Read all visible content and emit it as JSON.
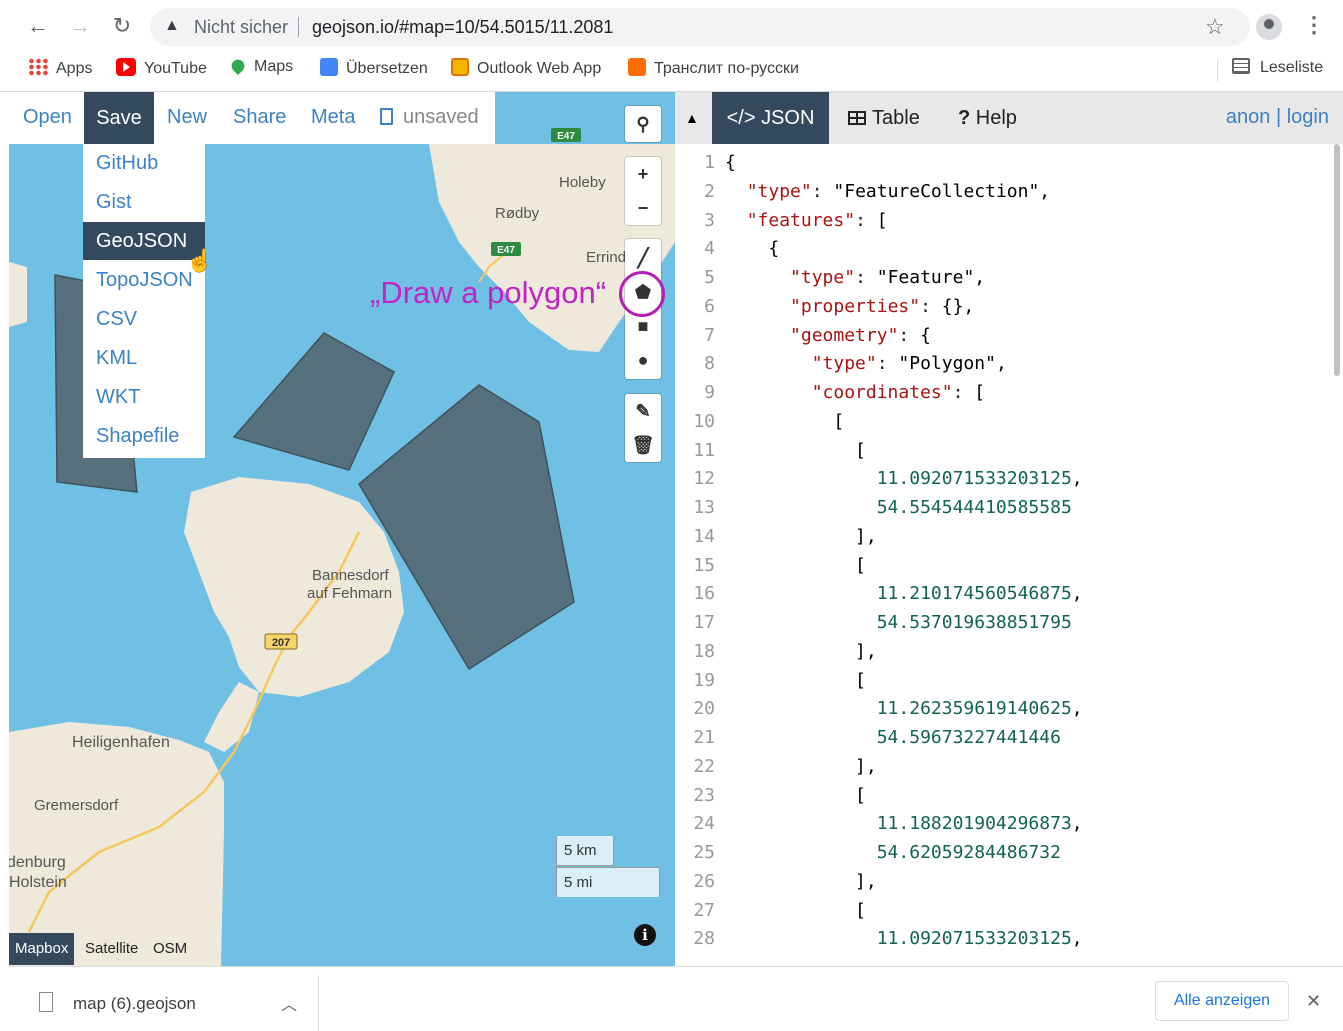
{
  "browser": {
    "insecure_label": "Nicht sicher",
    "url": "geojson.io/#map=10/54.5015/11.2081",
    "bookmarks": [
      {
        "label": "Apps",
        "icon": "apps-grid-icon"
      },
      {
        "label": "YouTube",
        "icon": "youtube-icon"
      },
      {
        "label": "Maps",
        "icon": "maps-pin-icon"
      },
      {
        "label": "Übersetzen",
        "icon": "translate-icon"
      },
      {
        "label": "Outlook Web App",
        "icon": "outlook-icon"
      },
      {
        "label": "Транслит по-русски",
        "icon": "translit-icon"
      }
    ],
    "reading_list": "Leseliste"
  },
  "app": {
    "menu": {
      "open": "Open",
      "save": "Save",
      "new": "New",
      "share": "Share",
      "meta": "Meta",
      "unsaved": "unsaved"
    },
    "save_dropdown": [
      "GitHub",
      "Gist",
      "GeoJSON",
      "TopoJSON",
      "CSV",
      "KML",
      "WKT",
      "Shapefile"
    ],
    "save_dropdown_active": "GeoJSON",
    "annotation": "„Draw a polygon“",
    "map_labels": {
      "holeby": "Holeby",
      "rodby": "Rødby",
      "errind": "Errind",
      "bannesdorf_1": "Bannesdorf",
      "bannesdorf_2": "auf Fehmarn",
      "heiligenhafen": "Heiligenhafen",
      "gremersdorf": "Gremersdorf",
      "oldenburg_1": "denburg",
      "oldenburg_2": "Holstein",
      "road_e47_a": "E47",
      "road_e47_b": "E47",
      "road_207": "207"
    },
    "scale": {
      "km": "5 km",
      "mi": "5 mi"
    },
    "layers": {
      "mapbox": "Mapbox",
      "satellite": "Satellite",
      "osm": "OSM",
      "active": "Mapbox"
    },
    "colors": {
      "accent": "#34495e",
      "link": "#3c82c8",
      "water": "#70c0e6",
      "land": "#efe9dc",
      "polygon": "#56707d"
    }
  },
  "panel": {
    "tabs": {
      "json": "</> JSON",
      "table": "Table",
      "help": "Help"
    },
    "help_glyph": "?",
    "active_tab": "JSON",
    "auth": {
      "anon": "anon",
      "separator": "|",
      "login": "login"
    },
    "code_lines": [
      {
        "n": "1",
        "t": "{"
      },
      {
        "n": "2",
        "t": "  \"type\": \"FeatureCollection\","
      },
      {
        "n": "3",
        "t": "  \"features\": ["
      },
      {
        "n": "4",
        "t": "    {"
      },
      {
        "n": "5",
        "t": "      \"type\": \"Feature\","
      },
      {
        "n": "6",
        "t": "      \"properties\": {},"
      },
      {
        "n": "7",
        "t": "      \"geometry\": {"
      },
      {
        "n": "8",
        "t": "        \"type\": \"Polygon\","
      },
      {
        "n": "9",
        "t": "        \"coordinates\": ["
      },
      {
        "n": "10",
        "t": "          ["
      },
      {
        "n": "11",
        "t": "            ["
      },
      {
        "n": "12",
        "t": "              11.092071533203125,"
      },
      {
        "n": "13",
        "t": "              54.554544410585585"
      },
      {
        "n": "14",
        "t": "            ],"
      },
      {
        "n": "15",
        "t": "            ["
      },
      {
        "n": "16",
        "t": "              11.210174560546875,"
      },
      {
        "n": "17",
        "t": "              54.537019638851795"
      },
      {
        "n": "18",
        "t": "            ],"
      },
      {
        "n": "19",
        "t": "            ["
      },
      {
        "n": "20",
        "t": "              11.262359619140625,"
      },
      {
        "n": "21",
        "t": "              54.59673227441446"
      },
      {
        "n": "22",
        "t": "            ],"
      },
      {
        "n": "23",
        "t": "            ["
      },
      {
        "n": "24",
        "t": "              11.188201904296873,"
      },
      {
        "n": "25",
        "t": "              54.62059284486732"
      },
      {
        "n": "26",
        "t": "            ],"
      },
      {
        "n": "27",
        "t": "            ["
      },
      {
        "n": "28",
        "t": "              11.092071533203125,"
      }
    ]
  },
  "downloads": {
    "file": "map (6).geojson",
    "show_all": "Alle anzeigen"
  }
}
